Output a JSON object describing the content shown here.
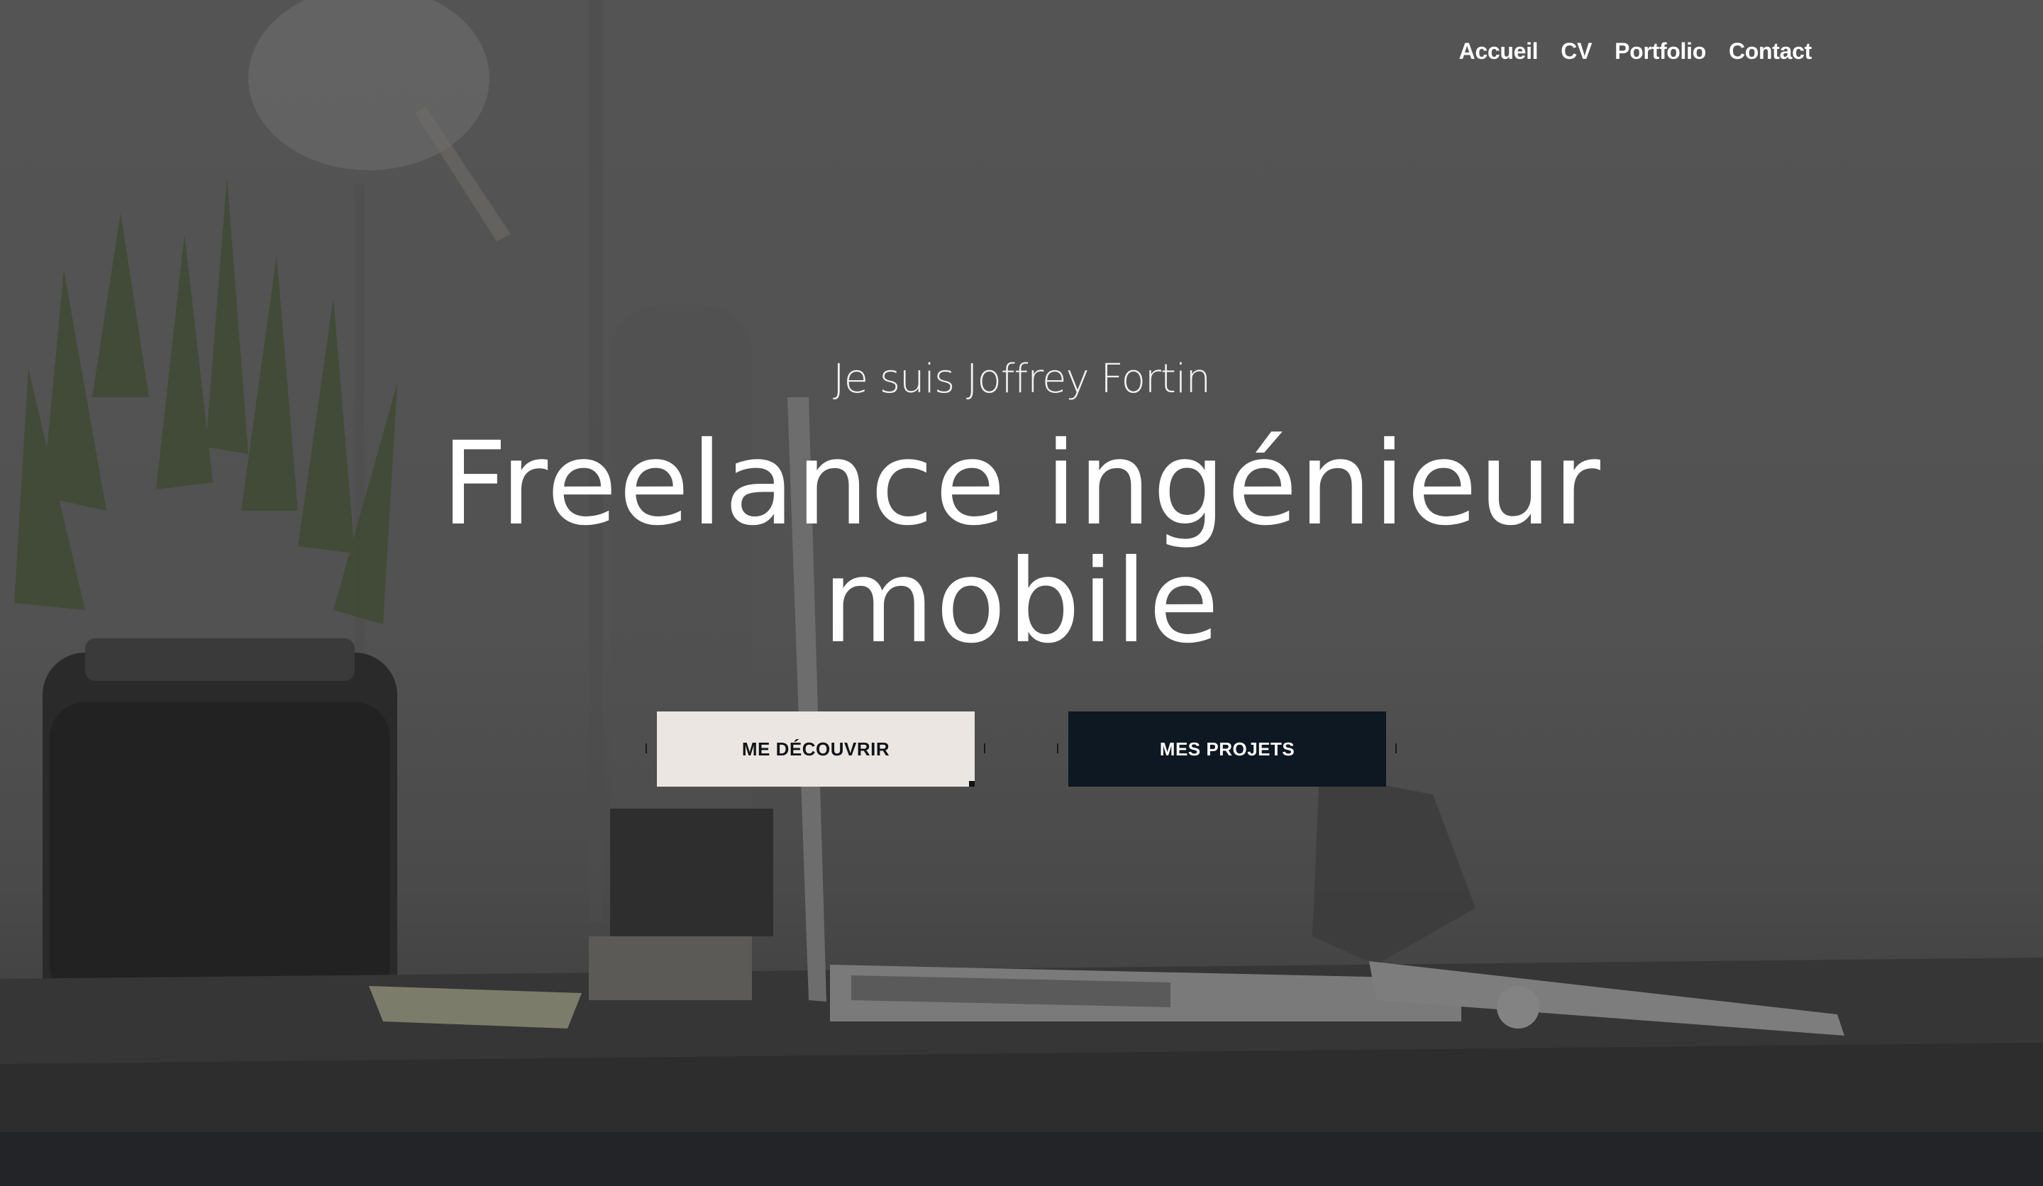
{
  "nav": {
    "items": [
      {
        "label": "Accueil"
      },
      {
        "label": "CV"
      },
      {
        "label": "Portfolio"
      },
      {
        "label": "Contact"
      }
    ]
  },
  "hero": {
    "intro": "Je suis Joffrey Fortin",
    "headline": "Freelance ingénieur\nmobile",
    "buttons": {
      "primary": "ME DÉCOUVRIR",
      "secondary": "MES PROJETS"
    }
  },
  "colors": {
    "overlay": "#545454",
    "primary_button_bg": "#ebe6e2",
    "secondary_button_bg": "#0e1822",
    "footer": "#232427"
  }
}
